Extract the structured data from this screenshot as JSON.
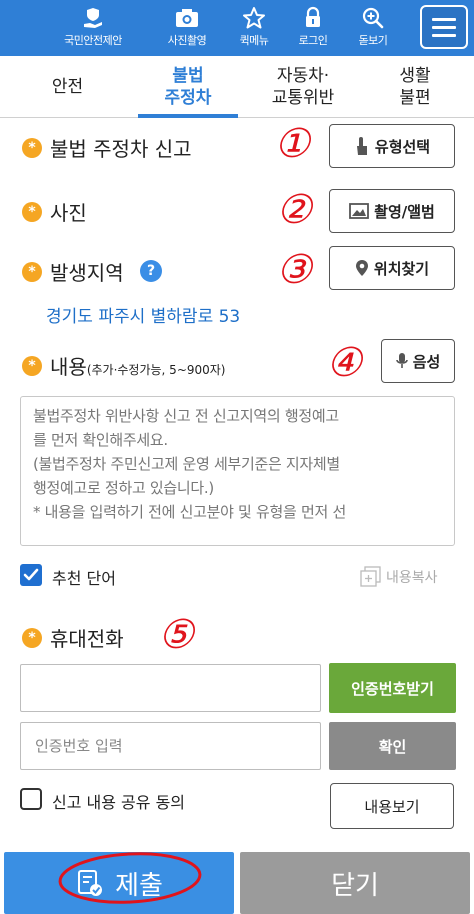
{
  "topbar": {
    "items": [
      {
        "label": "국민안전제안",
        "icon": "hand-shield-icon"
      },
      {
        "label": "사진촬영",
        "icon": "camera-icon"
      },
      {
        "label": "퀵메뉴",
        "icon": "star-icon"
      },
      {
        "label": "로그인",
        "icon": "lock-icon"
      },
      {
        "label": "돋보기",
        "icon": "zoom-plus-icon"
      }
    ],
    "menu_icon": "hamburger-icon",
    "color": "#2f7fd6"
  },
  "tabs": [
    {
      "label": "안전",
      "active": false
    },
    {
      "label": "불법\n주정차",
      "active": true
    },
    {
      "label": "자동차·\n교통위반",
      "active": false
    },
    {
      "label": "생활\n불편",
      "active": false
    }
  ],
  "form": {
    "report": {
      "label": "불법 주정차 신고",
      "button": "유형선택",
      "annotation": "①"
    },
    "photo": {
      "label": "사진",
      "button": "촬영/앨범",
      "annotation": "②"
    },
    "location": {
      "label": "발생지역",
      "help": "?",
      "button": "위치찾기",
      "address": "경기도 파주시 별하람로 53",
      "annotation": "③"
    },
    "content": {
      "label": "내용",
      "hint": "(추가·수정가능, 5~900자)",
      "button": "음성",
      "annotation": "④",
      "placeholder_lines": [
        "불법주정차 위반사항 신고 전 신고지역의 행정예고",
        "를 먼저 확인해주세요.",
        "(불법주정차 주민신고제 운영 세부기준은 지자체별",
        "행정예고로 정하고 있습니다.)",
        "* 내용을 입력하기 전에 신고분야 및 유형을 먼저 선"
      ]
    },
    "recommend": {
      "label": "추천 단어",
      "checked": true
    },
    "copy": {
      "label": "내용복사"
    },
    "phone": {
      "label": "휴대전화",
      "annotation": "⑤",
      "value": "",
      "get_code_button": "인증번호받기",
      "code_placeholder": "인증번호 입력",
      "confirm_button": "확인"
    },
    "share": {
      "label": "신고 내용 공유 동의",
      "checked": false,
      "view_button": "내용보기"
    }
  },
  "bottom": {
    "submit": "제출",
    "close": "닫기"
  },
  "colors": {
    "primary": "#2f7fd6",
    "required": "#f5a623",
    "green": "#6aa83a",
    "annotation": "#e0141c"
  }
}
